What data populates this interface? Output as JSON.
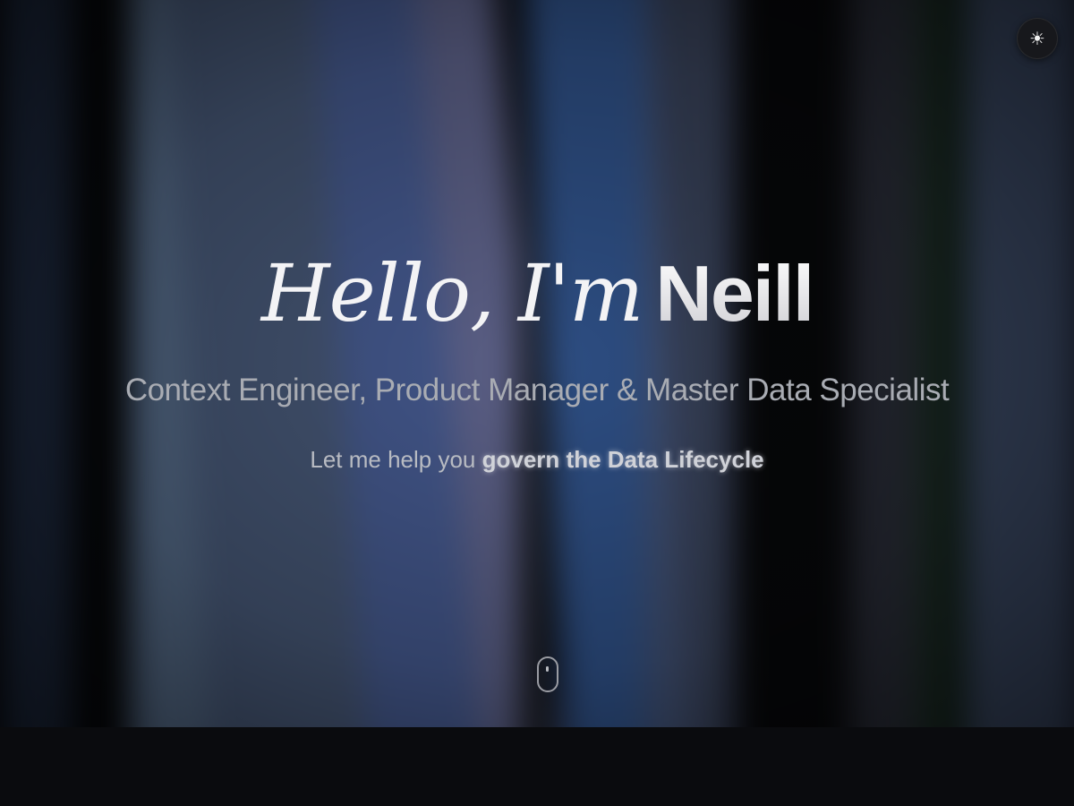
{
  "theme_toggle": {
    "icon": "sun-icon",
    "glyph": "☀"
  },
  "hero": {
    "greeting": "Hello, I'm",
    "name": "Neill",
    "subtitle": "Context Engineer, Product Manager & Master Data Specialist",
    "tagline_prefix": "Let me help you",
    "tagline_highlight": "govern the Data Lifecycle"
  },
  "scroll_indicator": {
    "icon": "mouse-scroll-icon"
  },
  "colors": {
    "background": "#0a0b0e",
    "headline": "#f3f3f5",
    "subtitle": "#a9acb3"
  }
}
